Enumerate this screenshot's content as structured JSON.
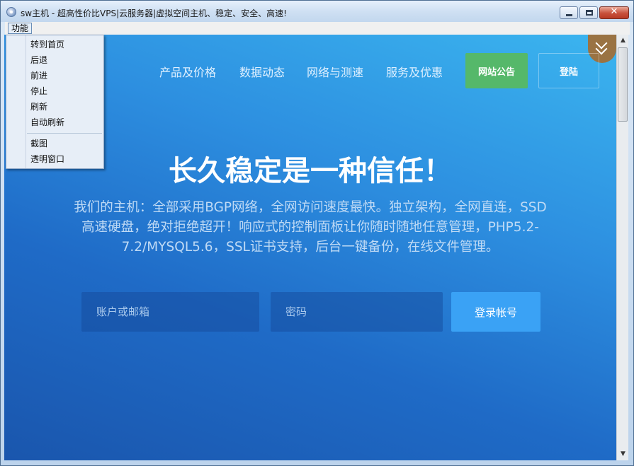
{
  "window": {
    "title": "sw主机 - 超高性价比VPS|云服务器|虚拟空间主机、稳定、安全、高速!",
    "close_glyph": "✕",
    "minimize_icon": "minimize-icon",
    "maximize_icon": "maximize-icon",
    "app_icon": "app-icon"
  },
  "menubar": {
    "function_label": "功能"
  },
  "dropdown": {
    "items": [
      "转到首页",
      "后退",
      "前进",
      "停止",
      "刷新",
      "自动刷新"
    ],
    "items_after_separator": [
      "截图",
      "透明窗口"
    ]
  },
  "site": {
    "nav": [
      "产品及价格",
      "数据动态",
      "网络与测速",
      "服务及优惠"
    ],
    "notice_label": "网站公告",
    "login_top_label": "登陆",
    "hero_title": "长久稳定是一种信任！",
    "hero_desc": "我们的主机：全部采用BGP网络，全网访问速度最快。独立架构，全网直连，SSD高速硬盘，绝对拒绝超开！响应式的控制面板让你随时随地任意管理，PHP5.2-7.2/MYSQL5.6，SSL证书支持，后台一键备份，在线文件管理。",
    "account_placeholder": "账户或邮箱",
    "password_placeholder": "密码",
    "submit_label": "登录帐号"
  },
  "scrollbar": {
    "up_arrow": "▲",
    "down_arrow": "▼"
  },
  "colors": {
    "notice_green": "#55b86a",
    "submit_blue": "#3aa2f5",
    "fold_tab_brown": "#9a7343"
  }
}
